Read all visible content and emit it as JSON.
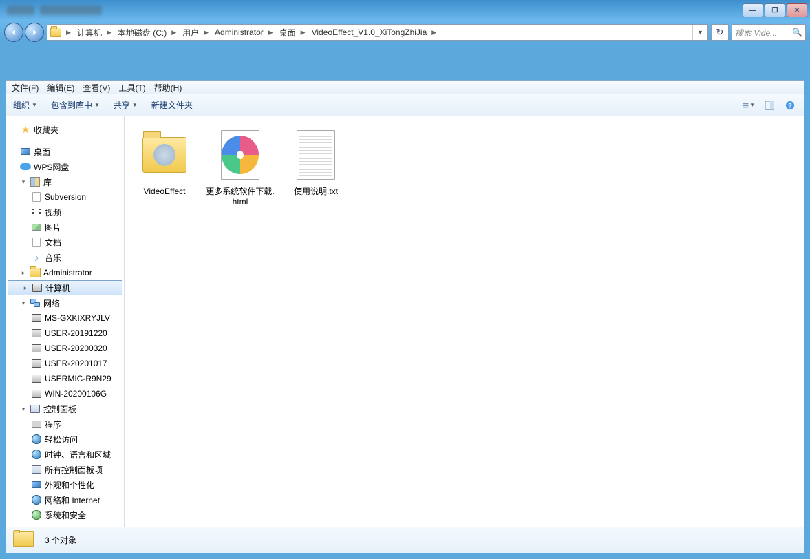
{
  "window": {
    "min": "—",
    "max": "❐",
    "close": "✕"
  },
  "breadcrumb": [
    "计算机",
    "本地磁盘 (C:)",
    "用户",
    "Administrator",
    "桌面",
    "VideoEffect_V1.0_XiTongZhiJia"
  ],
  "search": {
    "placeholder": "搜索 Vide..."
  },
  "menu": {
    "file": "文件(F)",
    "edit": "编辑(E)",
    "view": "查看(V)",
    "tools": "工具(T)",
    "help": "帮助(H)"
  },
  "toolbar": {
    "organize": "组织",
    "include": "包含到库中",
    "share": "共享",
    "newfolder": "新建文件夹"
  },
  "sidebar": {
    "favorites": "收藏夹",
    "desktop": "桌面",
    "wps": "WPS网盘",
    "libraries": "库",
    "lib_items": [
      "Subversion",
      "视频",
      "图片",
      "文档",
      "音乐"
    ],
    "admin": "Administrator",
    "computer": "计算机",
    "network": "网络",
    "net_items": [
      "MS-GXKIXRYJLV",
      "USER-20191220",
      "USER-20200320",
      "USER-20201017",
      "USERMIC-R9N29",
      "WIN-20200106G"
    ],
    "controlpanel": "控制面板",
    "cp_items": [
      "程序",
      "轻松访问",
      "时钟、语言和区域",
      "所有控制面板项",
      "外观和个性化",
      "网络和 Internet",
      "系统和安全"
    ]
  },
  "files": [
    {
      "name": "VideoEffect",
      "type": "folder"
    },
    {
      "name": "更多系统软件下载.html",
      "type": "html"
    },
    {
      "name": "使用说明.txt",
      "type": "txt"
    }
  ],
  "status": {
    "count": "3 个对象"
  }
}
